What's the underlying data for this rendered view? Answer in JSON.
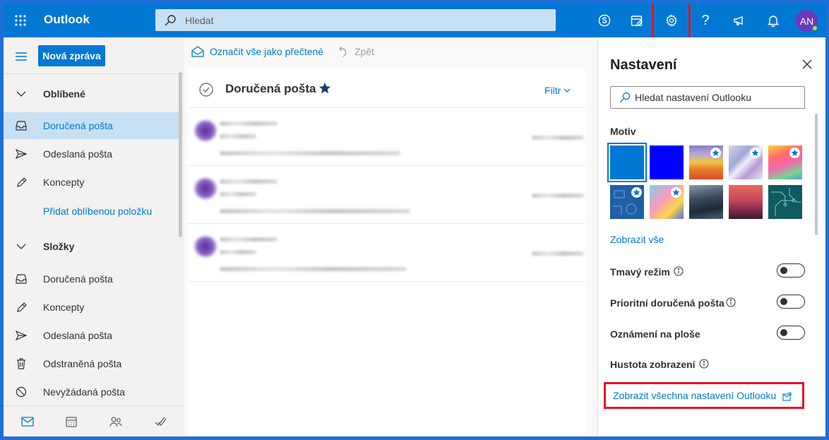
{
  "topbar": {
    "brand": "Outlook",
    "search_placeholder": "Hledat",
    "avatar_initials": "AN"
  },
  "leftnav": {
    "new_message": "Nová zpráva",
    "favorites_header": "Oblíbené",
    "favorites": [
      {
        "label": "Doručená pošta",
        "icon": "inbox-icon",
        "selected": true
      },
      {
        "label": "Odeslaná pošta",
        "icon": "send-icon"
      },
      {
        "label": "Koncepty",
        "icon": "pencil-icon"
      }
    ],
    "add_favorite": "Přidat oblíbenou položku",
    "folders_header": "Složky",
    "folders": [
      {
        "label": "Doručená pošta",
        "icon": "inbox-icon"
      },
      {
        "label": "Koncepty",
        "icon": "pencil-icon"
      },
      {
        "label": "Odeslaná pošta",
        "icon": "send-icon"
      },
      {
        "label": "Odstraněná pošta",
        "icon": "trash-icon"
      },
      {
        "label": "Nevyžádaná pošta",
        "icon": "blocked-icon"
      }
    ],
    "bottom_icons": [
      "mail-icon",
      "calendar-icon",
      "people-icon",
      "todo-icon"
    ]
  },
  "command_bar": {
    "mark_all_read": "Označit vše jako přečtené",
    "undo": "Zpět"
  },
  "maillist": {
    "title": "Doručená pošta",
    "filter": "Filtr"
  },
  "settings": {
    "title": "Nastavení",
    "search_placeholder": "Hledat nastavení Outlooku",
    "theme_section": "Motiv",
    "show_all": "Zobrazit vše",
    "dark_mode": "Tmavý režim",
    "focused_inbox": "Prioritní doručená pošta",
    "desktop_notifications": "Oznámení na ploše",
    "display_density": "Hustota zobrazení",
    "all_settings_link": "Zobrazit všechna nastavení Outlooku"
  },
  "colors": {
    "accent": "#0078d4",
    "highlight_box": "#e81123",
    "selected_nav": "#c7e0f4",
    "avatar": "#6b38bc"
  }
}
